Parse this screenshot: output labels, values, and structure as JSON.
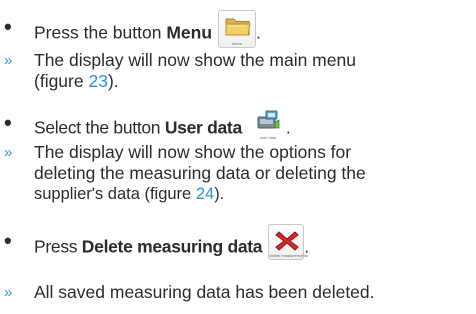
{
  "steps": [
    {
      "type": "action",
      "prefix": "Press the button ",
      "bold": "Menu",
      "icon": "folder-icon",
      "icon_caption": "menu",
      "suffix": "."
    },
    {
      "type": "result",
      "line1": "The display will now show the main menu",
      "line2_prefix": "(figure ",
      "figure": "23",
      "line2_suffix": ")."
    },
    {
      "type": "action",
      "prefix": "Select the button ",
      "bold": "User data",
      "icon": "user-data-icon",
      "icon_caption": "user data",
      "suffix": "."
    },
    {
      "type": "result",
      "line1": "The display will now show the options for",
      "line2": "deleting the measuring data or deleting the",
      "line3_prefix": "supplier's data (figure ",
      "figure": "24",
      "line3_suffix": ")."
    },
    {
      "type": "action",
      "prefix": "Press ",
      "bold": "Delete measuring data",
      "icon": "delete-x-icon",
      "icon_caption": "delete measurements",
      "suffix": "."
    },
    {
      "type": "result",
      "line1": "All saved measuring data has been deleted."
    }
  ],
  "markers": {
    "bullet": "•",
    "arrow": "»"
  },
  "colors": {
    "text": "#2b2b2b",
    "accent": "#2f8fd6",
    "delete_red": "#d8262b"
  }
}
